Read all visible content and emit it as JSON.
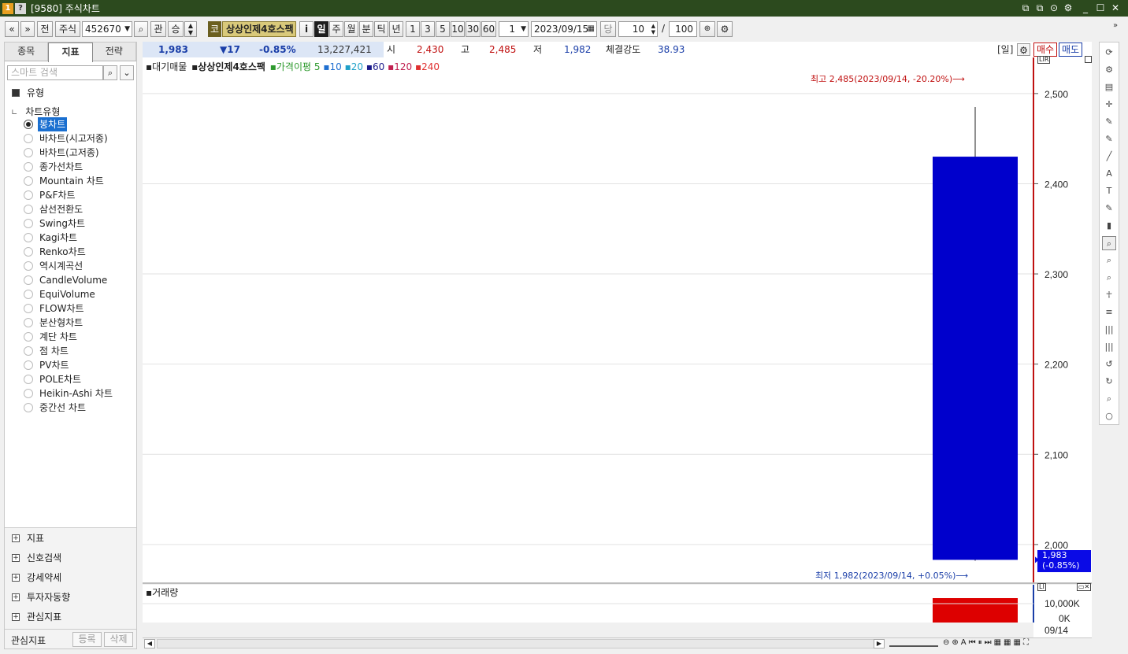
{
  "window": {
    "badge1": "1",
    "badge2": "?",
    "title": "[9580] 주식차트",
    "controls": [
      "⧉",
      "⧉",
      "⊙",
      "⚙",
      "_",
      "☐",
      "✕"
    ]
  },
  "toolbar": {
    "prev": "«",
    "dropdown": "»",
    "jeon": "전",
    "market": "주식",
    "code": "452670",
    "search_icon": "⌕",
    "gwan": "관",
    "seung": "승",
    "co_badge": "코",
    "stock_name": "상상인제4호스팩",
    "info_btn": "i",
    "periods": [
      "일",
      "주",
      "월",
      "분",
      "틱",
      "년"
    ],
    "active_period": "일",
    "intervals": [
      "1",
      "3",
      "5",
      "10",
      "30",
      "60"
    ],
    "multiplier": "1",
    "date": "2023/09/15",
    "dang": "당",
    "count": "10",
    "slash": "/",
    "total": "100",
    "expand": "»"
  },
  "left_panel": {
    "tabs": [
      "종목",
      "지표",
      "전략"
    ],
    "active_tab": "지표",
    "search_placeholder": "스마트 검색",
    "group_type": "유형",
    "subheader": "차트유형",
    "chart_types": [
      "봉차트",
      "바차트(시고저종)",
      "바차트(고저종)",
      "종가선차트",
      "Mountain 차트",
      "P&F차트",
      "삼선전환도",
      "Swing차트",
      "Kagi차트",
      "Renko차트",
      "역시계곡선",
      "CandleVolume",
      "EquiVolume",
      "FLOW차트",
      "분산형차트",
      "계단 차트",
      "점 차트",
      "PV차트",
      "POLE차트",
      "Heikin-Ashi 차트",
      "중간선 차트"
    ],
    "selected_type": "봉차트",
    "bottom_groups": [
      "지표",
      "신호검색",
      "강세약세",
      "투자자동향",
      "관심지표"
    ],
    "footer_label": "관심지표",
    "footer_btn1": "등록",
    "footer_btn2": "삭제"
  },
  "info_bar": {
    "price": "1,983",
    "change": "▼17",
    "change_pct": "-0.85%",
    "volume": "13,227,421",
    "open_label": "시",
    "open": "2,430",
    "high_label": "고",
    "high": "2,485",
    "low_label": "저",
    "low": "1,982",
    "strength_label": "체결강도",
    "strength": "38.93",
    "period_tag": "[일]",
    "buy": "매수",
    "sell": "매도"
  },
  "chart_data": {
    "type": "candlestick",
    "legend": {
      "item1": "대기매물",
      "item2": "상상인제4호스팩",
      "item3": "가격이평",
      "ma_periods": [
        "5",
        "10",
        "20",
        "60",
        "120",
        "240"
      ],
      "ma_colors": [
        "#2e9a2e",
        "#1f6fd0",
        "#1fa0c8",
        "#1a1a8a",
        "#c02050",
        "#e03030"
      ]
    },
    "y_ticks": [
      "2,500",
      "2,400",
      "2,300",
      "2,200",
      "2,100",
      "2,000"
    ],
    "y_tick_values": [
      2500,
      2400,
      2300,
      2200,
      2100,
      2000
    ],
    "ylim": [
      1958,
      2540
    ],
    "candle": {
      "date": "09/14",
      "open": 2430,
      "high": 2485,
      "low": 1982,
      "close": 1983
    },
    "candle_color": "#0000cc",
    "high_annotation": "최고 2,485(2023/09/14, -20.20%)⟶",
    "low_annotation": "최저 1,982(2023/09/14, +0.05%)⟶",
    "current_price_box": "1,983",
    "current_change_box": "(-0.85%)",
    "right_label": "LIR",
    "volume_panel": {
      "title": "거래량",
      "y_ticks": [
        "10,000K",
        "0K"
      ],
      "bar_value_k": 13227,
      "ylim_k": [
        0,
        10000
      ],
      "bar_color": "#dd0000"
    },
    "x_ticks": [
      "09/14"
    ]
  },
  "right_toolbar": {
    "icons": [
      "refresh-icon",
      "gear-icon",
      "chart-icon",
      "cross-icon",
      "pen-icon",
      "pen2-icon",
      "line-icon",
      "auto-icon",
      "text-icon",
      "shape-icon",
      "candle-icon",
      "zoom-in-icon",
      "zoom-list-icon",
      "zoom-area-icon",
      "person-icon",
      "lines-icon",
      "bars-icon",
      "bars2-icon",
      "undo-icon",
      "redo-icon",
      "magnify-icon",
      "circle-icon"
    ]
  }
}
